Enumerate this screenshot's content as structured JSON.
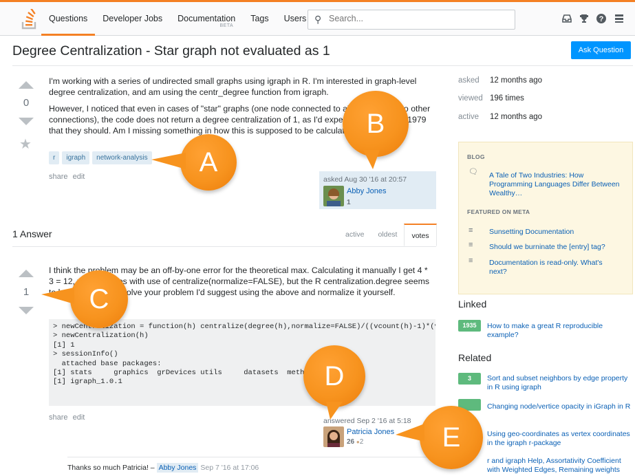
{
  "nav": {
    "items": [
      "Questions",
      "Developer Jobs",
      "Documentation",
      "Tags",
      "Users"
    ],
    "beta": "BETA",
    "search_placeholder": "Search..."
  },
  "question": {
    "title": "Degree Centralization - Star graph not evaluated as 1",
    "ask_button": "Ask Question",
    "votes": "0",
    "p1": "I'm working with a series of undirected small graphs using igraph in R. I'm interested in graph-level degree centralization, and am using the centr_degree function from igraph.",
    "p2": "However, I noticed that even in cases of \"star\" graphs (one node connected to all others, with no other connections), the code does not return a degree centralization of 1, as I'd expect from Freeman 1979 that they should. Am I missing something in how this is supposed to be calculated?",
    "tags": [
      "r",
      "igraph",
      "network-analysis"
    ],
    "menu": [
      "share",
      "edit"
    ],
    "asked": "asked Aug 30 '16 at 20:57",
    "user": "Abby Jones",
    "rep": "1"
  },
  "answers": {
    "header": "1 Answer",
    "sort_tabs": [
      "active",
      "oldest",
      "votes"
    ]
  },
  "answer": {
    "votes": "1",
    "text": "I think the problem may be an off-by-one error for the theoretical max. Calculating it manually I get 4 * 3 = 12, which agrees with use of centralize(normalize=FALSE), but the R centralization.degree seems to be 4 * 5 = 20. To solve your problem I'd suggest using the above and normalize it yourself.",
    "code": [
      "> newCentralization = function(h) centralize(degree(h),normalize=FALSE)/((vcount(h)-1)*(vcou",
      "> newCentralization(h)",
      "[1] 1",
      "",
      "> sessionInfo()",
      "  attached base packages:",
      "[1] stats     graphics  grDevices utils     datasets  methods   base",
      "[1] igraph_1.0.1"
    ],
    "menu": [
      "share",
      "edit"
    ],
    "answered": "answered Sep 2 '16 at 5:18",
    "user": "Patricia Jones",
    "rep": "26",
    "bronze": "2"
  },
  "comment": {
    "text": "Thanks so much Patricia! –",
    "user": "Abby Jones",
    "date": "Sep 7 '16 at 17:06"
  },
  "sidebar": {
    "stats": [
      {
        "label": "asked",
        "value": "12 months ago"
      },
      {
        "label": "viewed",
        "value": "196 times"
      },
      {
        "label": "active",
        "value": "12 months ago"
      }
    ],
    "blog_heading": "BLOG",
    "blog_item": "A Tale of Two Industries: How Programming Languages Differ Between Wealthy…",
    "meta_heading": "FEATURED ON META",
    "meta_items": [
      "Sunsetting Documentation",
      "Should we burninate the [entry] tag?",
      "Documentation is read-only. What's next?"
    ],
    "linked_heading": "Linked",
    "linked": [
      {
        "score": "1935",
        "title": "How to make a great R reproducible example?"
      }
    ],
    "related_heading": "Related",
    "related": [
      {
        "score": "3",
        "title": "Sort and subset neighbors by edge property in R using igraph"
      },
      {
        "score": "",
        "title": "Changing node/vertice opacity in iGraph in R"
      },
      {
        "score": "",
        "title": "Using geo-coordinates as vertex coordinates in the igraph r-package"
      },
      {
        "score": "",
        "title": "r and igraph Help, Assortativity Coefficient with Weighted Edges, Remaining weights"
      }
    ]
  },
  "callouts": [
    "A",
    "B",
    "C",
    "D",
    "E"
  ],
  "colors": {
    "accent": "#f48024",
    "link": "#0a60b5",
    "callout": "#f7931e",
    "badge": "#5eba7d"
  }
}
